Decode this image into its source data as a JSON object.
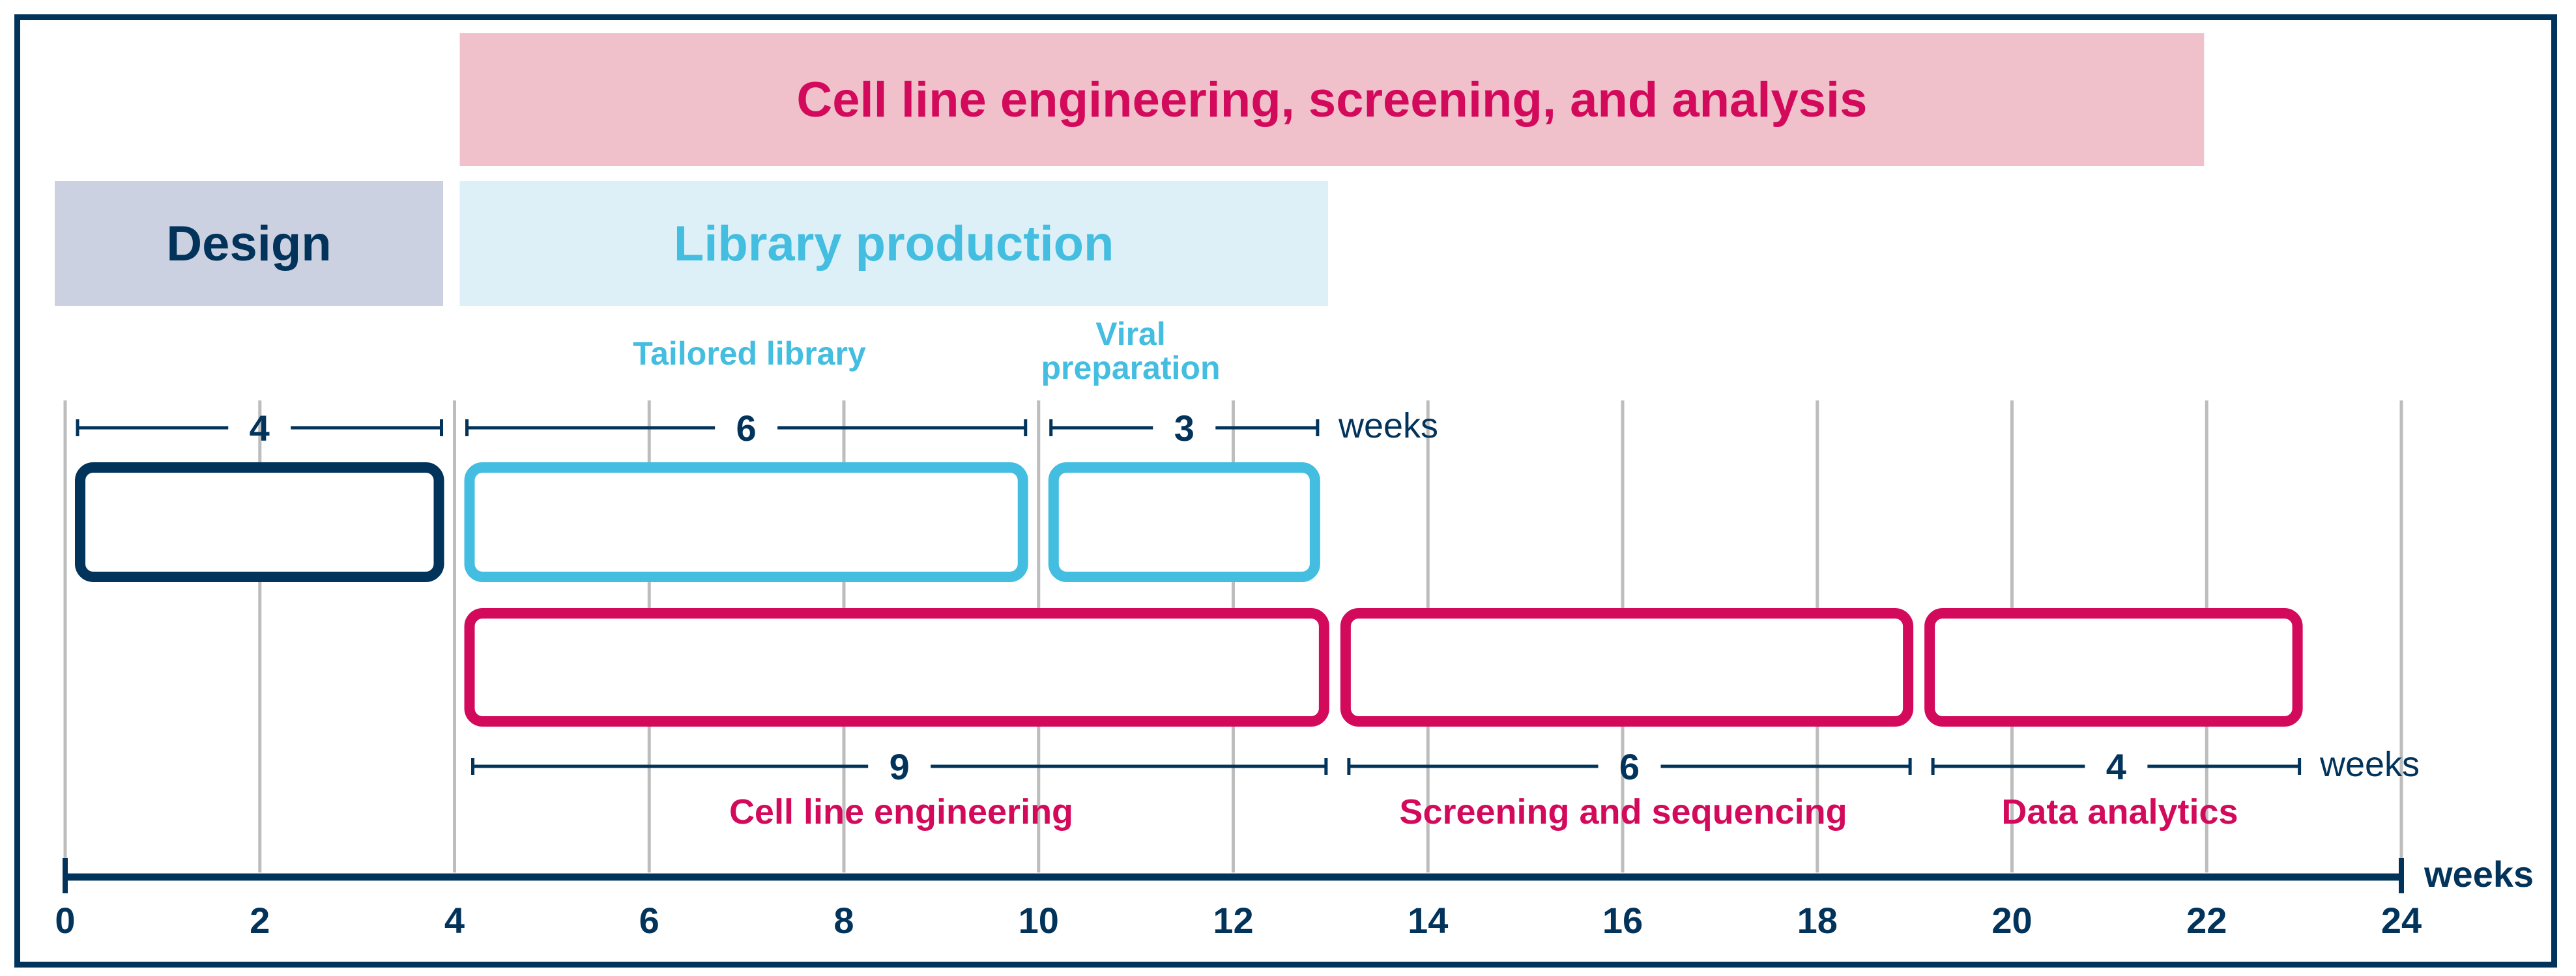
{
  "colors": {
    "navy": "#02335a",
    "cyan": "#43bde0",
    "magenta": "#d30a5b",
    "pink_band": "#f0c1cb",
    "cyan_band": "#ddf0f7",
    "navy_band": "#cbd1e0",
    "grid": "#bdbdbd"
  },
  "bands": [
    {
      "id": "cell-line-band",
      "label": "Cell line engineering, screening, and analysis",
      "start": 4,
      "end": 22,
      "color": "magenta",
      "fill": "pink_band"
    },
    {
      "id": "design-band",
      "label": "Design",
      "start": 0,
      "end": 4,
      "color": "navy",
      "fill": "navy_band"
    },
    {
      "id": "library-band",
      "label": "Library production",
      "start": 4,
      "end": 13,
      "color": "cyan",
      "fill": "cyan_band"
    }
  ],
  "top_row": {
    "sublabels": [
      {
        "id": "tailored-library-label",
        "lines": [
          "Tailored library"
        ],
        "center": 7
      },
      {
        "id": "viral-preparation-label",
        "lines": [
          "Viral",
          "preparation"
        ],
        "center": 11
      }
    ],
    "tasks": [
      {
        "id": "design",
        "duration_label": "4",
        "start": 0,
        "end": 4,
        "color": "navy"
      },
      {
        "id": "tailored-library",
        "duration_label": "6",
        "start": 4,
        "end": 10,
        "color": "cyan"
      },
      {
        "id": "viral-preparation",
        "duration_label": "3",
        "start": 10,
        "end": 13,
        "color": "cyan"
      }
    ],
    "unit_label": "weeks"
  },
  "bottom_row": {
    "tasks": [
      {
        "id": "cell-line-engineering",
        "duration_label": "9",
        "label": "Cell line engineering",
        "start": 4,
        "end": 13,
        "color": "magenta"
      },
      {
        "id": "screening-sequencing",
        "duration_label": "6",
        "label": "Screening and sequencing",
        "start": 13,
        "end": 19,
        "color": "magenta"
      },
      {
        "id": "data-analytics",
        "duration_label": "4",
        "label": "Data analytics",
        "start": 19,
        "end": 23,
        "color": "magenta"
      }
    ],
    "unit_label": "weeks"
  },
  "axis": {
    "min": 0,
    "max": 24,
    "ticks": [
      "0",
      "2",
      "4",
      "6",
      "8",
      "10",
      "12",
      "14",
      "16",
      "18",
      "20",
      "22",
      "24"
    ],
    "unit_label": "weeks"
  }
}
